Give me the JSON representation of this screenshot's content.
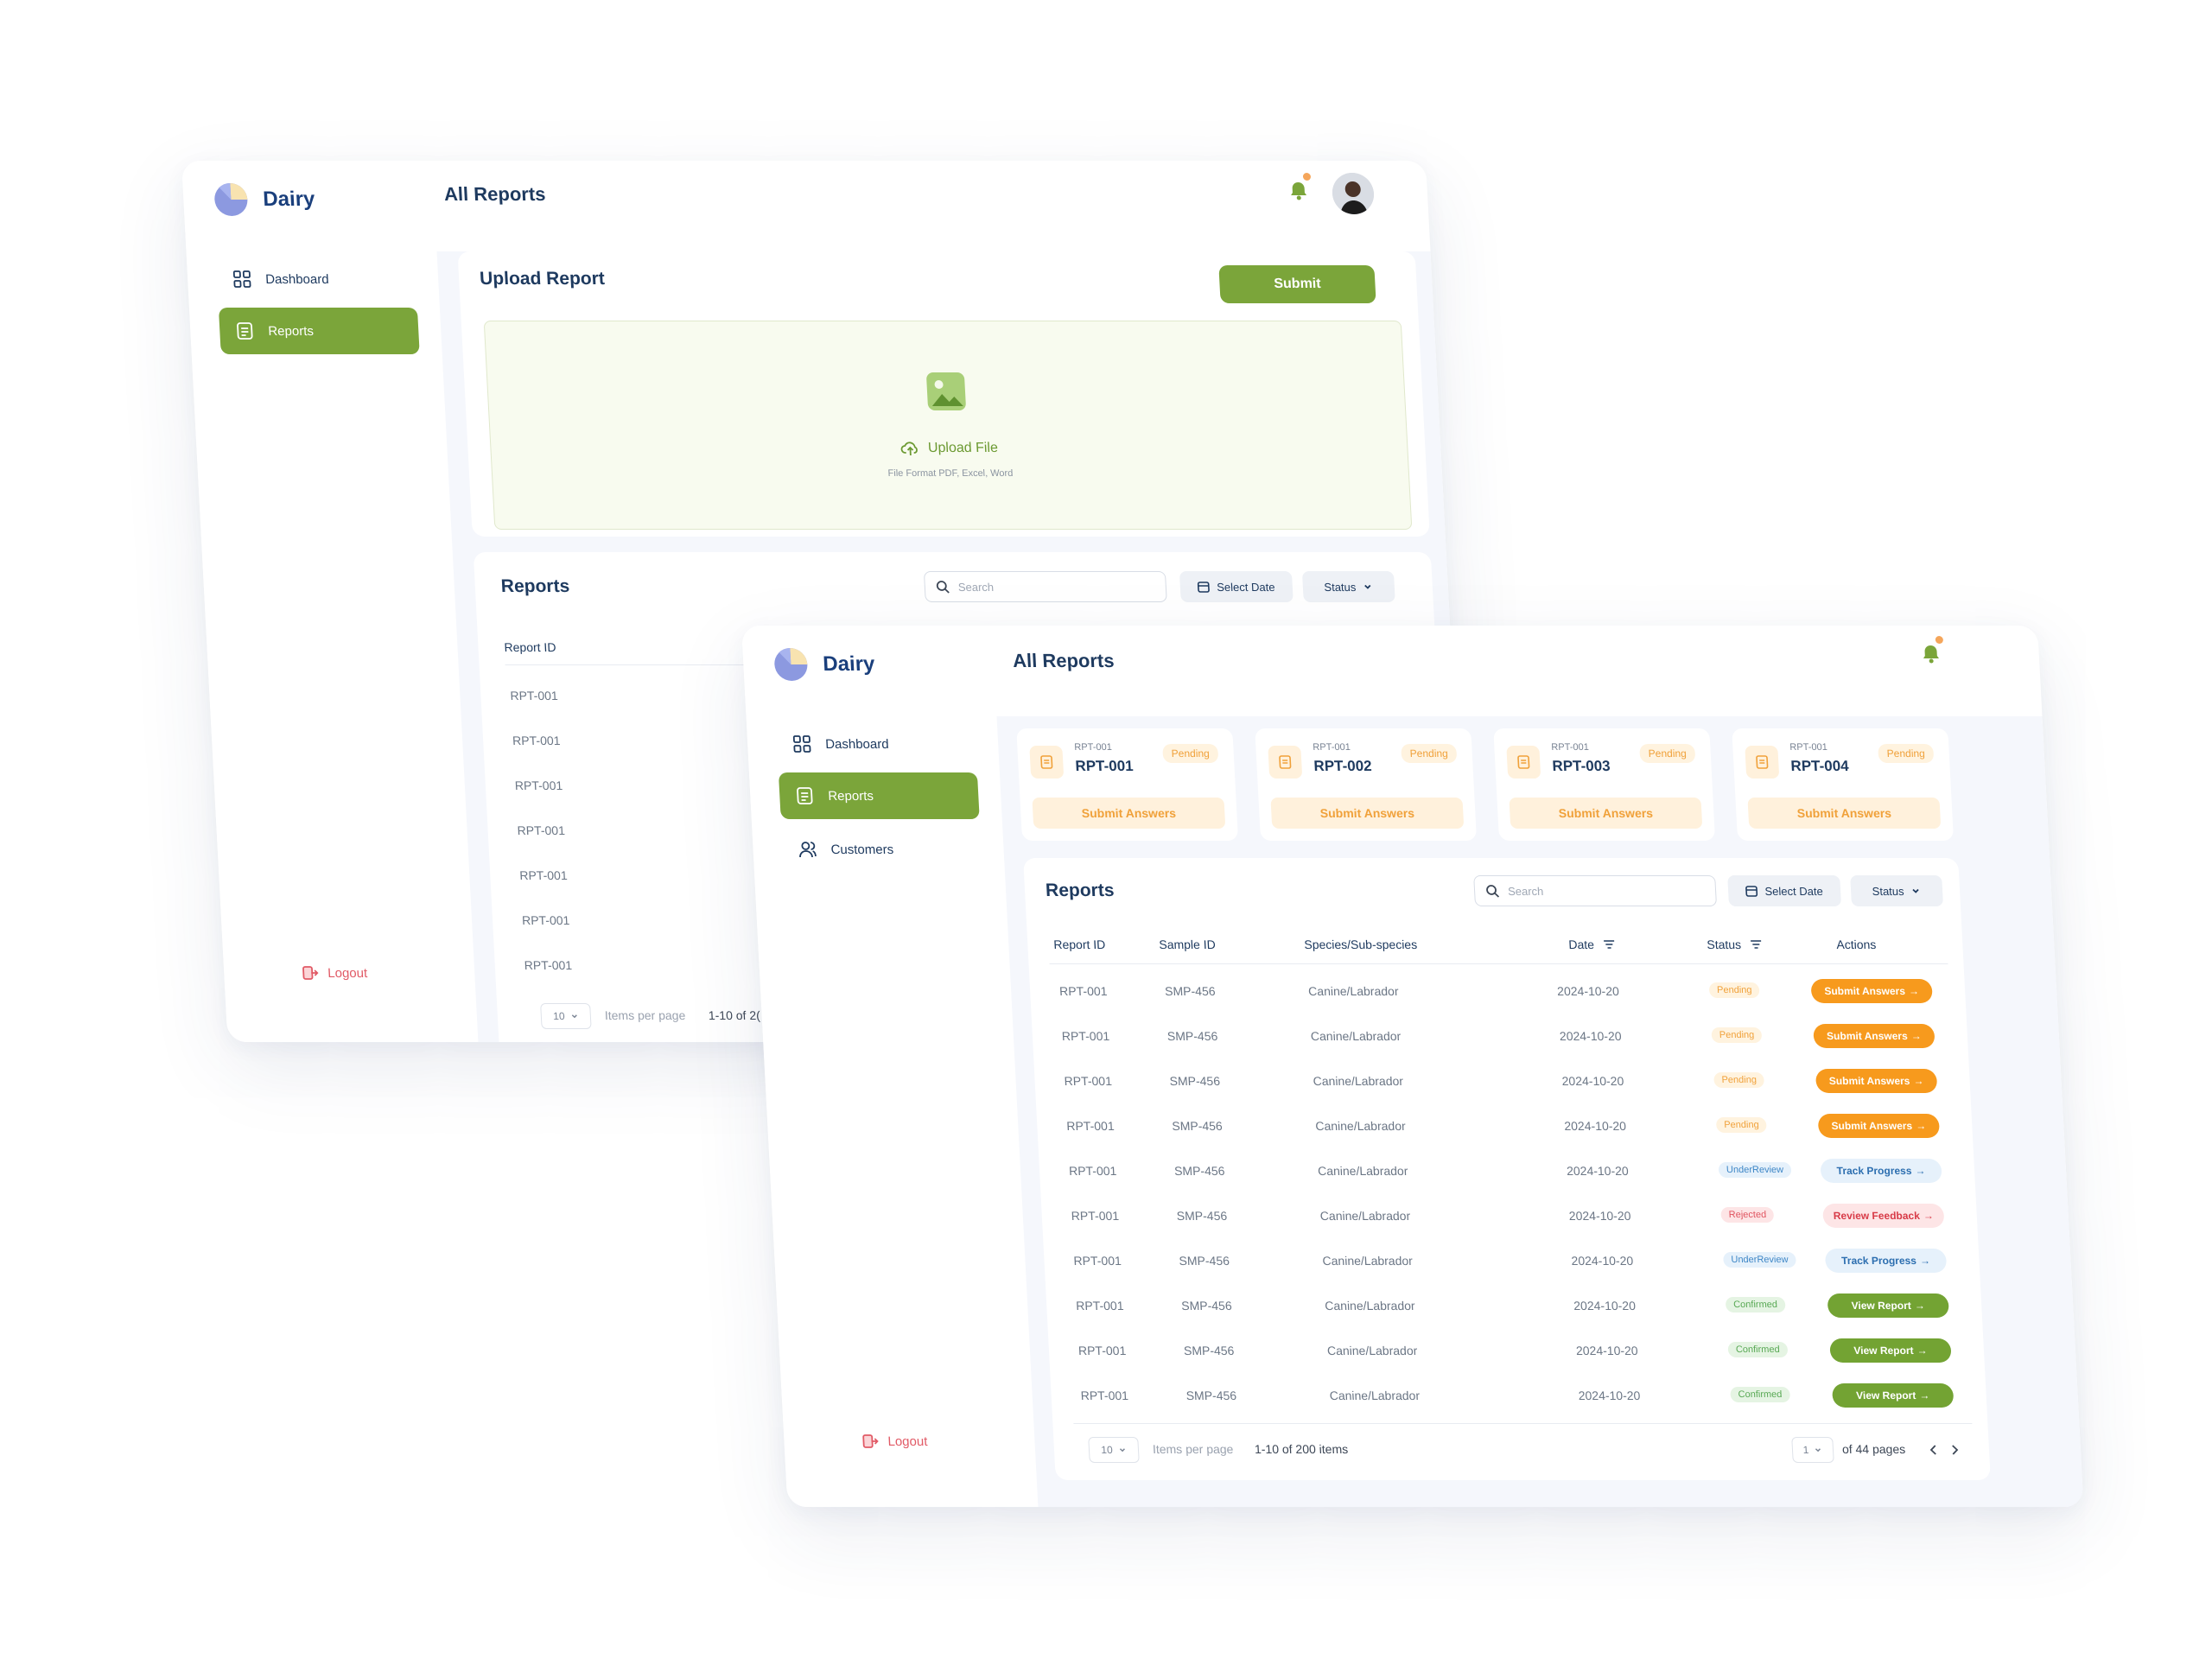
{
  "brand": {
    "name": "Dairy"
  },
  "header": {
    "title": "All Reports"
  },
  "colors": {
    "accent": "#7ba53a",
    "pending": "#f0a13a",
    "submit": "#f79a1d",
    "review": "#3d86c6",
    "rejected": "#e0535f",
    "confirmed": "#57a853",
    "logout": "#e15a66"
  },
  "window_upload": {
    "nav": [
      {
        "label": "Dashboard",
        "icon": "grid-icon",
        "active": false
      },
      {
        "label": "Reports",
        "icon": "document-icon",
        "active": true
      }
    ],
    "logout": "Logout",
    "upload": {
      "title": "Upload Report",
      "submit_label": "Submit",
      "upload_label": "Upload File",
      "hint": "File Format PDF, Excel, Word"
    },
    "reports": {
      "title": "Reports",
      "search_placeholder": "Search",
      "date_label": "Select Date",
      "status_label": "Status",
      "column": "Report ID",
      "rows": [
        "RPT-001",
        "RPT-001",
        "RPT-001",
        "RPT-001",
        "RPT-001",
        "RPT-001",
        "RPT-001"
      ],
      "per_page": "10",
      "per_page_label": "Items per page",
      "range_text": "1-10 of 2("
    }
  },
  "window_list": {
    "nav": [
      {
        "label": "Dashboard",
        "icon": "grid-icon",
        "active": false
      },
      {
        "label": "Reports",
        "icon": "document-icon",
        "active": true
      },
      {
        "label": "Customers",
        "icon": "users-icon",
        "active": false
      }
    ],
    "logout": "Logout",
    "cards": [
      {
        "small": "RPT-001",
        "id": "RPT-001",
        "status": "Pending",
        "action": "Submit Answers"
      },
      {
        "small": "RPT-001",
        "id": "RPT-002",
        "status": "Pending",
        "action": "Submit Answers"
      },
      {
        "small": "RPT-001",
        "id": "RPT-003",
        "status": "Pending",
        "action": "Submit Answers"
      },
      {
        "small": "RPT-001",
        "id": "RPT-004",
        "status": "Pending",
        "action": "Submit Answers"
      }
    ],
    "reports": {
      "title": "Reports",
      "search_placeholder": "Search",
      "date_label": "Select Date",
      "status_label": "Status",
      "columns": [
        "Report ID",
        "Sample ID",
        "Species/Sub-species",
        "Date",
        "Status",
        "Actions"
      ],
      "rows": [
        {
          "report_id": "RPT-001",
          "sample_id": "SMP-456",
          "species": "Canine/Labrador",
          "date": "2024-10-20",
          "status": "Pending",
          "status_kind": "pending",
          "action": "Submit Answers",
          "action_kind": "submit"
        },
        {
          "report_id": "RPT-001",
          "sample_id": "SMP-456",
          "species": "Canine/Labrador",
          "date": "2024-10-20",
          "status": "Pending",
          "status_kind": "pending",
          "action": "Submit Answers",
          "action_kind": "submit"
        },
        {
          "report_id": "RPT-001",
          "sample_id": "SMP-456",
          "species": "Canine/Labrador",
          "date": "2024-10-20",
          "status": "Pending",
          "status_kind": "pending",
          "action": "Submit Answers",
          "action_kind": "submit"
        },
        {
          "report_id": "RPT-001",
          "sample_id": "SMP-456",
          "species": "Canine/Labrador",
          "date": "2024-10-20",
          "status": "Pending",
          "status_kind": "pending",
          "action": "Submit Answers",
          "action_kind": "submit"
        },
        {
          "report_id": "RPT-001",
          "sample_id": "SMP-456",
          "species": "Canine/Labrador",
          "date": "2024-10-20",
          "status": "UnderReview",
          "status_kind": "review",
          "action": "Track Progress",
          "action_kind": "track"
        },
        {
          "report_id": "RPT-001",
          "sample_id": "SMP-456",
          "species": "Canine/Labrador",
          "date": "2024-10-20",
          "status": "Rejected",
          "status_kind": "rejected",
          "action": "Review  Feedback",
          "action_kind": "feedback"
        },
        {
          "report_id": "RPT-001",
          "sample_id": "SMP-456",
          "species": "Canine/Labrador",
          "date": "2024-10-20",
          "status": "UnderReview",
          "status_kind": "review",
          "action": "Track Progress",
          "action_kind": "track"
        },
        {
          "report_id": "RPT-001",
          "sample_id": "SMP-456",
          "species": "Canine/Labrador",
          "date": "2024-10-20",
          "status": "Confirmed",
          "status_kind": "confirmed",
          "action": "View Report",
          "action_kind": "view"
        },
        {
          "report_id": "RPT-001",
          "sample_id": "SMP-456",
          "species": "Canine/Labrador",
          "date": "2024-10-20",
          "status": "Confirmed",
          "status_kind": "confirmed",
          "action": "View Report",
          "action_kind": "view"
        },
        {
          "report_id": "RPT-001",
          "sample_id": "SMP-456",
          "species": "Canine/Labrador",
          "date": "2024-10-20",
          "status": "Confirmed",
          "status_kind": "confirmed",
          "action": "View Report",
          "action_kind": "view"
        }
      ],
      "per_page": "10",
      "per_page_label": "Items per page",
      "range_text": "1-10 of 200 items",
      "page": "1",
      "pages_text": "of 44 pages"
    }
  }
}
